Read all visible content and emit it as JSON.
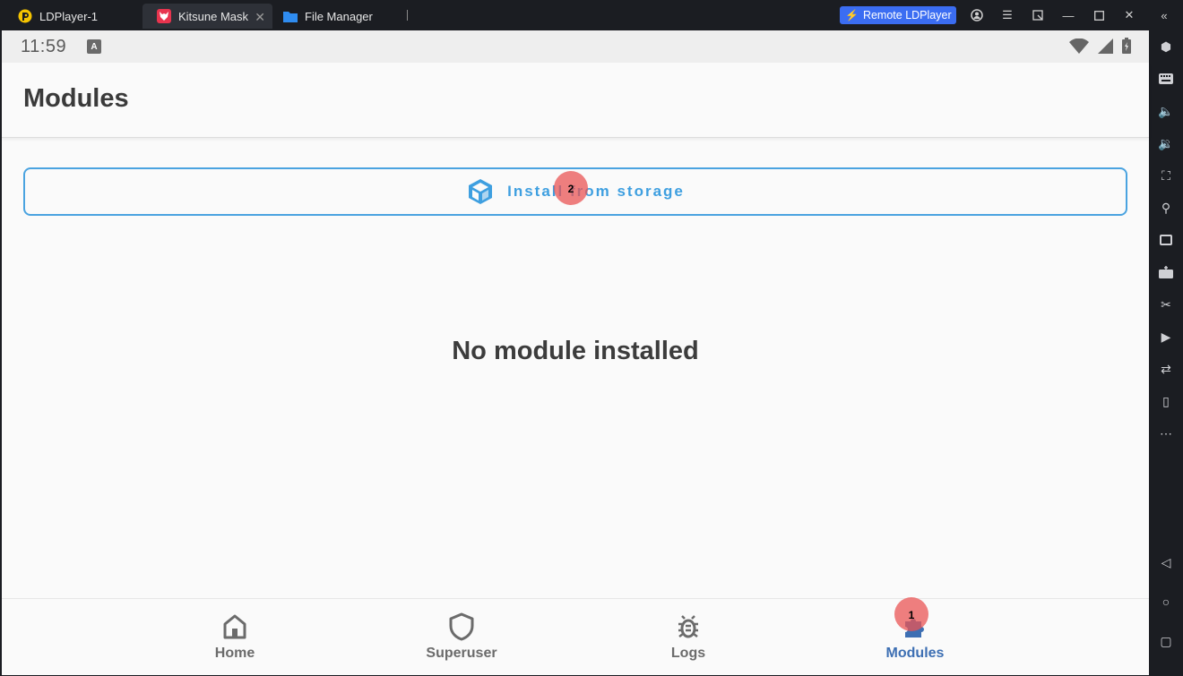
{
  "titlebar": {
    "tabs": [
      {
        "label": "LDPlayer-1"
      },
      {
        "label": "Kitsune Mask"
      },
      {
        "label": "File Manager"
      }
    ],
    "remote_label": "Remote LDPlayer"
  },
  "status": {
    "time": "11:59",
    "a_badge": "A"
  },
  "page": {
    "title": "Modules",
    "install_label": "Install from storage",
    "empty_text": "No module installed"
  },
  "nav": [
    {
      "label": "Home"
    },
    {
      "label": "Superuser"
    },
    {
      "label": "Logs"
    },
    {
      "label": "Modules"
    }
  ],
  "markers": [
    "1",
    "2"
  ],
  "colors": {
    "accent": "#3e9fe0",
    "nav_active": "#3d6fb3",
    "marker": "#ea5454",
    "remote_button": "#3b6df2"
  }
}
